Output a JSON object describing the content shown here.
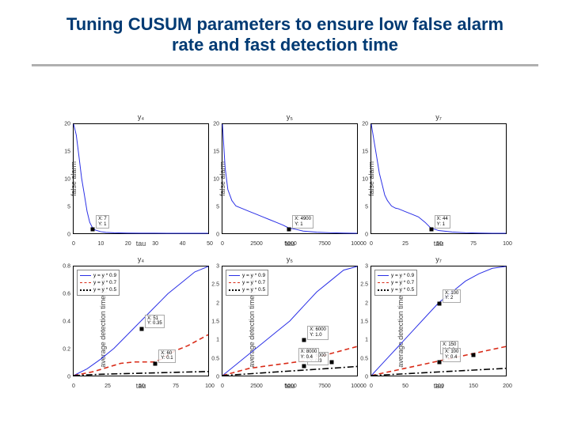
{
  "slide": {
    "title": "Tuning CUSUM parameters to ensure low false alarm rate and fast detection time"
  },
  "colors": {
    "line_blue": "#2a2fe6",
    "line_red": "#d92b18",
    "line_black": "#000000",
    "marker": "#000000"
  },
  "chart_data": [
    {
      "type": "line",
      "title": "y₄",
      "xlabel": "tau",
      "ylabel": "false alarm",
      "xlim": [
        0,
        50
      ],
      "ylim": [
        0,
        20
      ],
      "xticks": [
        0,
        10,
        20,
        30,
        40,
        50
      ],
      "yticks": [
        0,
        5,
        10,
        15,
        20
      ],
      "series": [
        {
          "name": "false_alarm",
          "color": "#2a2fe6",
          "style": "solid",
          "x": [
            0,
            1,
            2,
            3,
            4,
            5,
            6,
            7,
            8,
            10,
            12,
            15,
            20,
            25,
            30,
            35,
            40,
            45,
            50
          ],
          "y": [
            20,
            18,
            14,
            10,
            7,
            4,
            2,
            1,
            0.6,
            0.3,
            0.15,
            0.08,
            0.04,
            0.02,
            0.01,
            0.005,
            0,
            0,
            0
          ]
        }
      ],
      "markers": [
        {
          "x": 7,
          "y": 1,
          "label": "X: 7\nY: 1"
        }
      ],
      "legend": null
    },
    {
      "type": "line",
      "title": "y₅",
      "xlabel": "tau",
      "ylabel": "false alarm",
      "xlim": [
        0,
        10000
      ],
      "ylim": [
        0,
        20
      ],
      "xticks": [
        0,
        2500,
        5000,
        7500,
        10000
      ],
      "yticks": [
        0,
        5,
        10,
        15,
        20
      ],
      "series": [
        {
          "name": "false_alarm",
          "color": "#2a2fe6",
          "style": "solid",
          "x": [
            0,
            200,
            400,
            700,
            1000,
            1500,
            2000,
            2500,
            3000,
            3500,
            4000,
            4500,
            4900,
            5500,
            6000,
            7000,
            8000,
            9000,
            10000
          ],
          "y": [
            20,
            12,
            8,
            6,
            5,
            4.5,
            4,
            3.5,
            3,
            2.5,
            2,
            1.5,
            1,
            0.7,
            0.4,
            0.2,
            0.1,
            0.05,
            0
          ]
        }
      ],
      "markers": [
        {
          "x": 4900,
          "y": 1,
          "label": "X: 4900\nY: 1"
        }
      ],
      "legend": null
    },
    {
      "type": "line",
      "title": "y₇",
      "xlabel": "tau",
      "ylabel": "false alarm",
      "xlim": [
        0,
        100
      ],
      "ylim": [
        0,
        20
      ],
      "xticks": [
        0,
        25,
        50,
        75,
        100
      ],
      "yticks": [
        0,
        5,
        10,
        15,
        20
      ],
      "series": [
        {
          "name": "false_alarm",
          "color": "#2a2fe6",
          "style": "solid",
          "x": [
            0,
            2,
            4,
            6,
            8,
            10,
            12,
            15,
            18,
            20,
            25,
            30,
            35,
            40,
            44,
            50,
            60,
            70,
            80,
            90,
            100
          ],
          "y": [
            20,
            17,
            14,
            11,
            9,
            7,
            6,
            5,
            4.6,
            4.5,
            4,
            3.5,
            3,
            2,
            1,
            0.5,
            0.25,
            0.1,
            0.05,
            0,
            0
          ]
        }
      ],
      "markers": [
        {
          "x": 44,
          "y": 1,
          "label": "X: 44\nY: 1"
        }
      ],
      "legend": null
    },
    {
      "type": "line",
      "title": "y₄",
      "xlabel": "tau",
      "ylabel": "average detection time (hour)",
      "xlim": [
        0,
        100
      ],
      "ylim": [
        0,
        0.8
      ],
      "xticks": [
        0,
        25,
        50,
        75,
        100
      ],
      "yticks": [
        0,
        0.2,
        0.4,
        0.6,
        0.8
      ],
      "series": [
        {
          "name": "y = y * 0.9",
          "color": "#2a2fe6",
          "style": "solid",
          "x": [
            0,
            10,
            20,
            30,
            40,
            50,
            60,
            65,
            70,
            80,
            90,
            100
          ],
          "y": [
            0,
            0.05,
            0.12,
            0.2,
            0.3,
            0.4,
            0.5,
            0.55,
            0.6,
            0.68,
            0.76,
            0.8
          ]
        },
        {
          "name": "y = y * 0.7",
          "color": "#d92b18",
          "style": "dashed",
          "x": [
            0,
            15,
            25,
            35,
            45,
            55,
            60,
            65,
            75,
            85,
            100
          ],
          "y": [
            0,
            0.03,
            0.06,
            0.09,
            0.1,
            0.1,
            0.1,
            0.12,
            0.18,
            0.22,
            0.3
          ]
        },
        {
          "name": "y = y * 0.5",
          "color": "#000000",
          "style": "dashdot",
          "x": [
            0,
            20,
            40,
            60,
            80,
            100
          ],
          "y": [
            0,
            0.01,
            0.015,
            0.02,
            0.025,
            0.03
          ]
        }
      ],
      "markers": [
        {
          "x": 50,
          "y": 0.35,
          "label": "X: 51\nY: 0.35"
        },
        {
          "x": 60,
          "y": 0.1,
          "label": "X: 60\nY: 0.1"
        }
      ],
      "legend": {
        "pos": "top-left",
        "items": [
          "y = y * 0.9",
          "y = y * 0.7",
          "y = y * 0.5"
        ]
      }
    },
    {
      "type": "line",
      "title": "y₅",
      "xlabel": "tau",
      "ylabel": "average detection time (hour)",
      "xlim": [
        0,
        10000
      ],
      "ylim": [
        0,
        3
      ],
      "xticks": [
        0,
        2500,
        5000,
        7500,
        10000
      ],
      "yticks": [
        0,
        0.5,
        1,
        1.5,
        2,
        2.5,
        3
      ],
      "series": [
        {
          "name": "y = y * 0.9",
          "color": "#2a2fe6",
          "style": "solid",
          "x": [
            0,
            1000,
            2000,
            3000,
            4000,
            5000,
            6000,
            7000,
            8000,
            9000,
            10000
          ],
          "y": [
            0,
            0.3,
            0.6,
            0.9,
            1.2,
            1.5,
            1.9,
            2.3,
            2.6,
            2.9,
            3.0
          ]
        },
        {
          "name": "y = y * 0.7",
          "color": "#d92b18",
          "style": "dashed",
          "x": [
            0,
            1000,
            2000,
            3000,
            4000,
            5000,
            6000,
            7000,
            8000,
            9000,
            10000
          ],
          "y": [
            0,
            0.1,
            0.2,
            0.25,
            0.3,
            0.35,
            0.4,
            0.5,
            0.6,
            0.7,
            0.8
          ]
        },
        {
          "name": "y = y * 0.5",
          "color": "#000000",
          "style": "dashdot",
          "x": [
            0,
            2000,
            4000,
            6000,
            8000,
            10000
          ],
          "y": [
            0,
            0.05,
            0.1,
            0.15,
            0.2,
            0.25
          ]
        }
      ],
      "markers": [
        {
          "x": 6000,
          "y": 1.0,
          "label": "X: 6000\nY: 1.0"
        },
        {
          "x": 6000,
          "y": 0.3,
          "label": "X: 6000\nY: 0.3"
        },
        {
          "x": 8000,
          "y": 0.4,
          "label": "X: 8000\nY: 0.4"
        }
      ],
      "legend": {
        "pos": "top-left",
        "items": [
          "y = y * 0.9",
          "y = y * 0.7",
          "y = y * 0.5"
        ]
      }
    },
    {
      "type": "line",
      "title": "y₇",
      "xlabel": "tau",
      "ylabel": "average detection time (hour)",
      "xlim": [
        0,
        200
      ],
      "ylim": [
        0,
        3
      ],
      "xticks": [
        0,
        50,
        100,
        150,
        200
      ],
      "yticks": [
        0,
        0.5,
        1,
        1.5,
        2,
        2.5,
        3
      ],
      "series": [
        {
          "name": "y = y * 0.9",
          "color": "#2a2fe6",
          "style": "solid",
          "x": [
            0,
            20,
            40,
            60,
            80,
            100,
            120,
            140,
            160,
            180,
            200
          ],
          "y": [
            0,
            0.4,
            0.8,
            1.2,
            1.6,
            2.0,
            2.3,
            2.6,
            2.8,
            2.95,
            3.0
          ]
        },
        {
          "name": "y = y * 0.7",
          "color": "#d92b18",
          "style": "dashed",
          "x": [
            0,
            25,
            50,
            75,
            100,
            125,
            150,
            175,
            200
          ],
          "y": [
            0,
            0.1,
            0.2,
            0.3,
            0.4,
            0.5,
            0.6,
            0.7,
            0.8
          ]
        },
        {
          "name": "y = y * 0.5",
          "color": "#000000",
          "style": "dashdot",
          "x": [
            0,
            50,
            100,
            150,
            200
          ],
          "y": [
            0,
            0.05,
            0.1,
            0.15,
            0.2
          ]
        }
      ],
      "markers": [
        {
          "x": 100,
          "y": 2.0,
          "label": "X: 100\nY: 2"
        },
        {
          "x": 150,
          "y": 0.6,
          "label": "X: 150\nY: 0.6"
        },
        {
          "x": 100,
          "y": 0.4,
          "label": "X: 100\nY: 0.4"
        }
      ],
      "legend": {
        "pos": "top-left",
        "items": [
          "y = y * 0.9",
          "y = y * 0.7",
          "y = y * 0.5"
        ]
      }
    }
  ]
}
